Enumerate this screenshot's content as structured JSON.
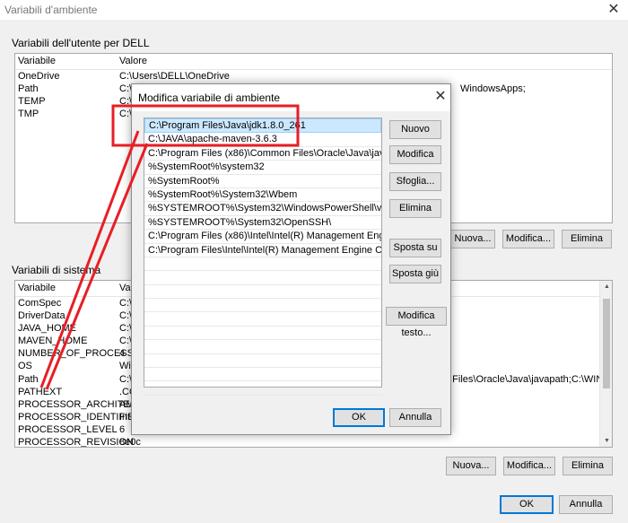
{
  "window": {
    "title": "Variabili d'ambiente"
  },
  "user_group": {
    "label": "Variabili dell'utente per DELL",
    "columns": [
      "Variabile",
      "Valore"
    ],
    "rows": [
      [
        "OneDrive",
        "C:\\Users\\DELL\\OneDrive"
      ],
      [
        "Path",
        "C:\\"
      ],
      [
        "TEMP",
        "C:\\"
      ],
      [
        "TMP",
        "C:\\"
      ]
    ],
    "path_tail": "WindowsApps;",
    "buttons": {
      "new": "Nuova...",
      "edit": "Modifica...",
      "delete": "Elimina"
    }
  },
  "system_group": {
    "label": "Variabili di sistema",
    "columns": [
      "Variabile",
      "Valore"
    ],
    "rows": [
      [
        "ComSpec",
        "C:\\"
      ],
      [
        "DriverData",
        "C:\\"
      ],
      [
        "JAVA_HOME",
        "C:\\"
      ],
      [
        "MAVEN_HOME",
        "C:\\"
      ],
      [
        "NUMBER_OF_PROCESSORS",
        "4"
      ],
      [
        "OS",
        "Win"
      ],
      [
        "Path",
        "C:\\"
      ],
      [
        "PATHEXT",
        ".CO"
      ],
      [
        "PROCESSOR_ARCHITECTU...",
        "AM"
      ],
      [
        "PROCESSOR_IDENTIFIER",
        "Inte"
      ],
      [
        "PROCESSOR_LEVEL",
        "6"
      ],
      [
        "PROCESSOR_REVISION",
        "8e0c"
      ]
    ],
    "path_tail": "n Files\\Oracle\\Java\\javapath;C:\\WINDO...",
    "buttons": {
      "new": "Nuova...",
      "edit": "Modifica...",
      "delete": "Elimina"
    }
  },
  "footer": {
    "ok": "OK",
    "cancel": "Annulla"
  },
  "dialog": {
    "title": "Modifica variabile di ambiente",
    "entries": [
      "C:\\Program Files\\Java\\jdk1.8.0_261",
      "C:\\JAVA\\apache-maven-3.6.3",
      "C:\\Program Files (x86)\\Common Files\\Oracle\\Java\\javapath",
      "%SystemRoot%\\system32",
      "%SystemRoot%",
      "%SystemRoot%\\System32\\Wbem",
      "%SYSTEMROOT%\\System32\\WindowsPowerShell\\v1.0\\",
      "%SYSTEMROOT%\\System32\\OpenSSH\\",
      "C:\\Program Files (x86)\\Intel\\Intel(R) Management Engine Comp...",
      "C:\\Program Files\\Intel\\Intel(R) Management Engine Components..."
    ],
    "selected_index": 0,
    "buttons": {
      "new": "Nuovo",
      "edit": "Modifica",
      "browse": "Sfoglia...",
      "delete": "Elimina",
      "move_up": "Sposta su",
      "move_down": "Sposta giù",
      "edit_text": "Modifica testo..."
    },
    "ok": "OK",
    "cancel": "Annulla"
  },
  "annotation": {
    "color": "#e81e25"
  }
}
